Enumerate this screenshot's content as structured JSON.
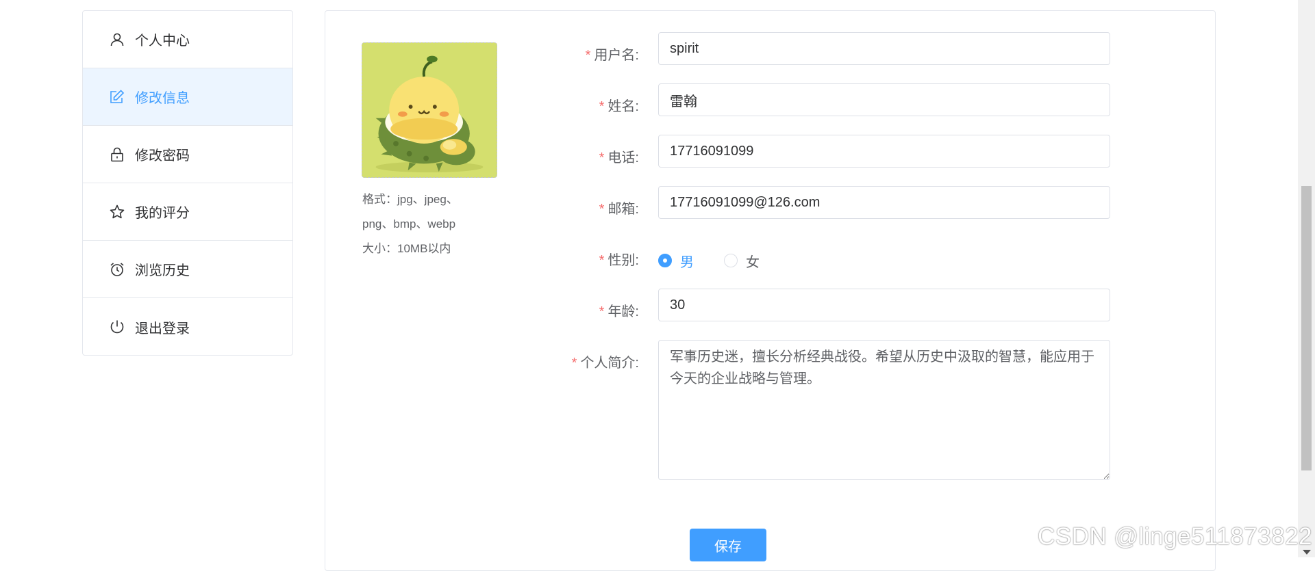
{
  "sidebar": {
    "items": [
      {
        "label": "个人中心",
        "icon": "user-icon",
        "active": false
      },
      {
        "label": "修改信息",
        "icon": "edit-icon",
        "active": true
      },
      {
        "label": "修改密码",
        "icon": "lock-icon",
        "active": false
      },
      {
        "label": "我的评分",
        "icon": "star-icon",
        "active": false
      },
      {
        "label": "浏览历史",
        "icon": "alarm-clock-icon",
        "active": false
      },
      {
        "label": "退出登录",
        "icon": "power-icon",
        "active": false
      }
    ]
  },
  "avatar": {
    "tips": [
      "格式：jpg、jpeg、",
      "png、bmp、webp",
      "大小：10MB以内"
    ]
  },
  "form": {
    "username": {
      "label": "用户名:",
      "value": "spirit"
    },
    "name": {
      "label": "姓名:",
      "value": "雷翰"
    },
    "phone": {
      "label": "电话:",
      "value": "17716091099"
    },
    "email": {
      "label": "邮箱:",
      "value": "17716091099@126.com"
    },
    "gender": {
      "label": "性别:",
      "options": [
        "男",
        "女"
      ],
      "selected": "男"
    },
    "age": {
      "label": "年龄:",
      "value": "30"
    },
    "bio": {
      "label": "个人简介:",
      "value": "军事历史迷，擅长分析经典战役。希望从历史中汲取的智慧，能应用于今天的企业战略与管理。"
    },
    "required_mark": "*"
  },
  "actions": {
    "save_label": "保存"
  },
  "watermark": "CSDN @linge511873822",
  "colors": {
    "accent": "#409eff",
    "required": "#f56c6c",
    "active_bg": "#ecf5ff"
  }
}
